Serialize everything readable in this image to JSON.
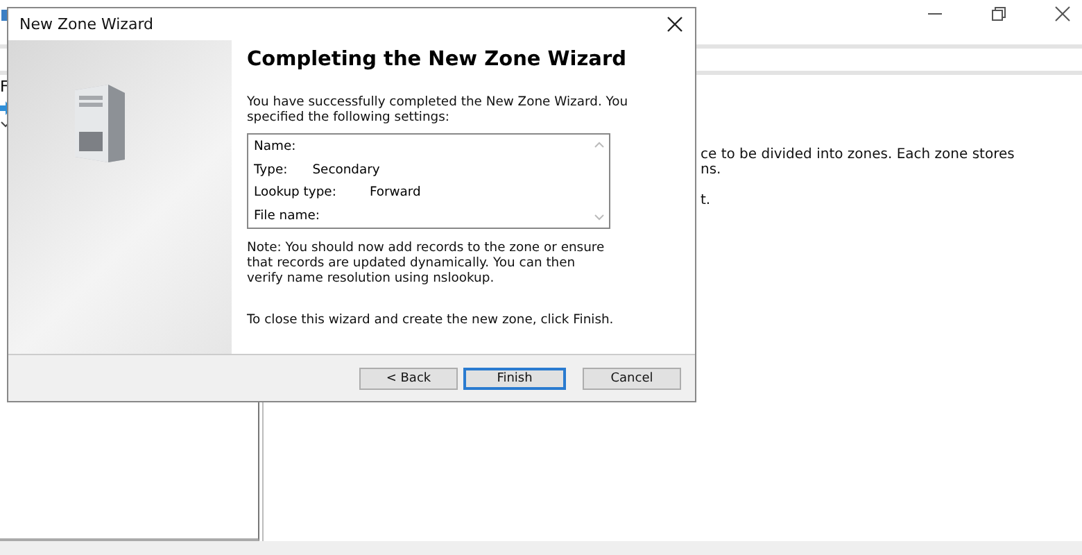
{
  "background_window": {
    "menu_letter": "F",
    "description_lines": [
      "ce to be divided into zones. Each zone stores",
      "ns.",
      "t."
    ]
  },
  "dialog": {
    "title": "New Zone Wizard",
    "heading": "Completing the New Zone Wizard",
    "intro": "You have successfully completed the New Zone Wizard. You specified the following settings:",
    "settings": [
      {
        "label": "Name:"
      },
      {
        "label": "Type:",
        "value": "Secondary"
      },
      {
        "label": "Lookup type:",
        "value": "Forward"
      },
      {
        "label": "File name:"
      }
    ],
    "note": "Note: You should now add records to the zone or ensure that records are updated dynamically. You can then verify name resolution using nslookup.",
    "closing": "To close this wizard and create the new zone, click Finish.",
    "buttons": [
      {
        "label": "< Back",
        "focused": false
      },
      {
        "label": "Finish",
        "focused": true
      },
      {
        "label": "Cancel",
        "focused": false
      }
    ]
  }
}
